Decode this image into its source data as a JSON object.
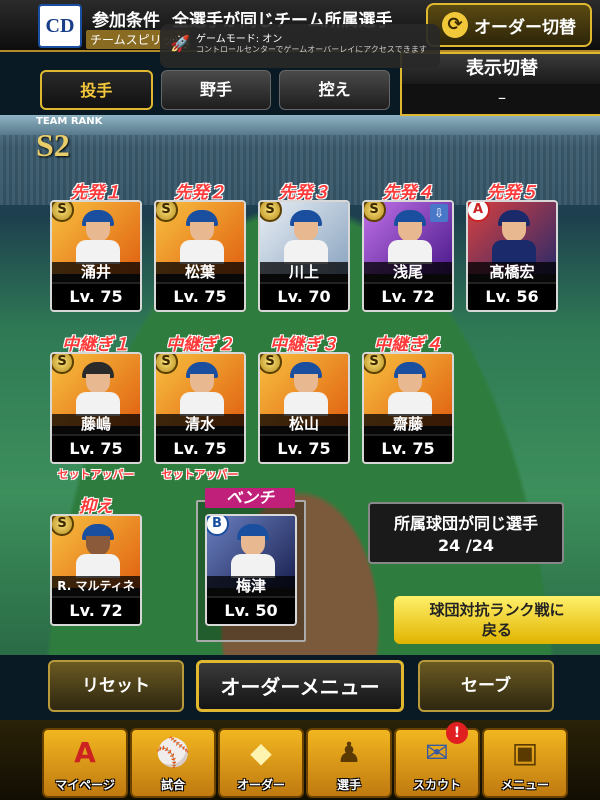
{
  "header": {
    "team_logo": "CD",
    "condition_label": "参加条件",
    "condition_text": "全選手が同じチーム所属選手",
    "chemistry_label": "チームスピリッツ",
    "order_switch_label": "オーダー切替"
  },
  "notification": {
    "title": "ゲームモード: オン",
    "body": "コントロールセンターでゲームオーバーレイにアクセスできます"
  },
  "tabs": [
    {
      "label": "投手",
      "active": true
    },
    {
      "label": "野手",
      "active": false
    },
    {
      "label": "控え",
      "active": false
    }
  ],
  "display_switch": {
    "label": "表示切替",
    "value": "–"
  },
  "team_rank": {
    "label": "TEAM RANK",
    "value": "S2"
  },
  "starters": [
    {
      "slot": "先発１",
      "badge": "S",
      "name": "涌井",
      "level": "Lv. 75"
    },
    {
      "slot": "先発２",
      "badge": "S",
      "name": "松葉",
      "level": "Lv. 75"
    },
    {
      "slot": "先発３",
      "badge": "S",
      "name": "川上",
      "level": "Lv. 70"
    },
    {
      "slot": "先発４",
      "badge": "S",
      "name": "浅尾",
      "level": "Lv. 72",
      "up_icon": true
    },
    {
      "slot": "先発５",
      "badge": "A",
      "name": "髙橋宏",
      "level": "Lv. 56"
    }
  ],
  "relievers": [
    {
      "slot": "中継ぎ１",
      "badge": "S",
      "name": "藤嶋",
      "level": "Lv. 75",
      "role": "セットアッパー"
    },
    {
      "slot": "中継ぎ２",
      "badge": "S",
      "name": "清水",
      "level": "Lv. 75",
      "role": "セットアッパー"
    },
    {
      "slot": "中継ぎ３",
      "badge": "S",
      "name": "松山",
      "level": "Lv. 75",
      "role": ""
    },
    {
      "slot": "中継ぎ４",
      "badge": "S",
      "name": "齋藤",
      "level": "Lv. 75",
      "role": ""
    }
  ],
  "closer": {
    "slot": "抑え",
    "badge": "S",
    "name": "R. マルティネス",
    "level": "Lv. 72"
  },
  "bench": {
    "slot": "ベンチ",
    "badge": "B",
    "name": "梅津",
    "level": "Lv. 50"
  },
  "same_team": {
    "label": "所属球団が同じ選手",
    "value": "24 /24"
  },
  "back_button": {
    "line1": "球団対抗ランク戦に",
    "line2": "戻る"
  },
  "actions": {
    "reset": "リセット",
    "order_menu": "オーダーメニュー",
    "save": "セーブ"
  },
  "nav": [
    {
      "label": "マイページ",
      "icon": "A"
    },
    {
      "label": "試合",
      "icon": "⚾"
    },
    {
      "label": "オーダー",
      "icon": "◆"
    },
    {
      "label": "選手",
      "icon": "♟"
    },
    {
      "label": "スカウト",
      "icon": "✉"
    },
    {
      "label": "メニュー",
      "icon": "▣"
    }
  ],
  "alert_badge": "!"
}
